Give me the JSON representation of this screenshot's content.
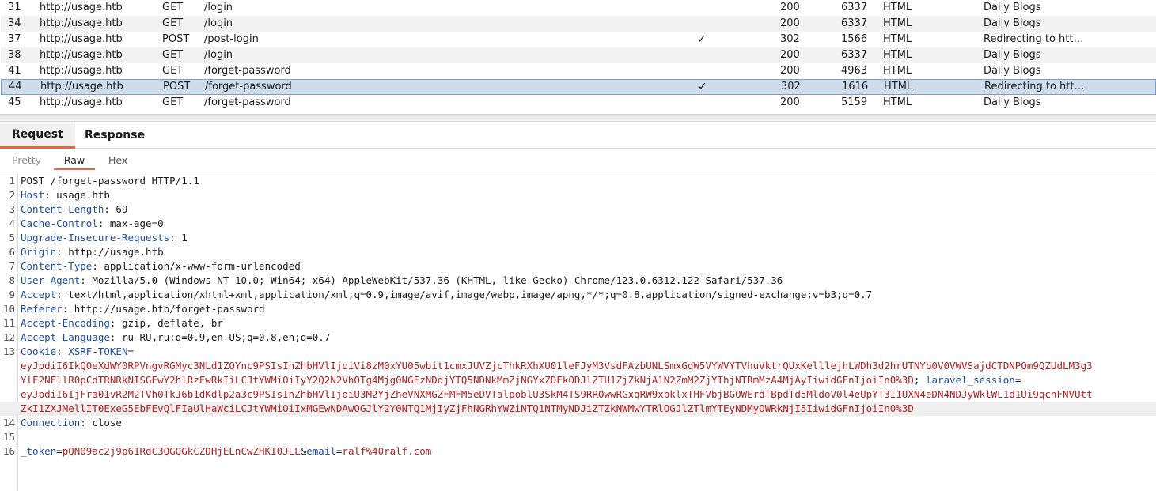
{
  "history": {
    "rows": [
      {
        "num": "31",
        "host": "http://usage.htb",
        "method": "GET",
        "url": "/login",
        "edited": "",
        "status": "200",
        "length": "6337",
        "mime": "HTML",
        "title": "Daily Blogs"
      },
      {
        "num": "34",
        "host": "http://usage.htb",
        "method": "GET",
        "url": "/login",
        "edited": "",
        "status": "200",
        "length": "6337",
        "mime": "HTML",
        "title": "Daily Blogs"
      },
      {
        "num": "37",
        "host": "http://usage.htb",
        "method": "POST",
        "url": "/post-login",
        "edited": "✓",
        "status": "302",
        "length": "1566",
        "mime": "HTML",
        "title": "Redirecting to htt…"
      },
      {
        "num": "38",
        "host": "http://usage.htb",
        "method": "GET",
        "url": "/login",
        "edited": "",
        "status": "200",
        "length": "6337",
        "mime": "HTML",
        "title": "Daily Blogs"
      },
      {
        "num": "41",
        "host": "http://usage.htb",
        "method": "GET",
        "url": "/forget-password",
        "edited": "",
        "status": "200",
        "length": "4963",
        "mime": "HTML",
        "title": "Daily Blogs"
      },
      {
        "num": "44",
        "host": "http://usage.htb",
        "method": "POST",
        "url": "/forget-password",
        "edited": "✓",
        "status": "302",
        "length": "1616",
        "mime": "HTML",
        "title": "Redirecting to htt…"
      },
      {
        "num": "45",
        "host": "http://usage.htb",
        "method": "GET",
        "url": "/forget-password",
        "edited": "",
        "status": "200",
        "length": "5159",
        "mime": "HTML",
        "title": "Daily Blogs"
      }
    ]
  },
  "tabs": {
    "request": "Request",
    "response": "Response"
  },
  "subtabs": {
    "pretty": "Pretty",
    "raw": "Raw",
    "hex": "Hex"
  },
  "editor": {
    "lines": [
      {
        "n": "1",
        "plain": "POST /forget-password HTTP/1.1"
      },
      {
        "n": "2",
        "name": "Host",
        "value": "usage.htb"
      },
      {
        "n": "3",
        "name": "Content-Length",
        "value": "69"
      },
      {
        "n": "4",
        "name": "Cache-Control",
        "value": "max-age=0"
      },
      {
        "n": "5",
        "name": "Upgrade-Insecure-Requests",
        "value": "1"
      },
      {
        "n": "6",
        "name": "Origin",
        "value": "http://usage.htb"
      },
      {
        "n": "7",
        "name": "Content-Type",
        "value": "application/x-www-form-urlencoded"
      },
      {
        "n": "8",
        "name": "User-Agent",
        "value": "Mozilla/5.0 (Windows NT 10.0; Win64; x64) AppleWebKit/537.36 (KHTML, like Gecko) Chrome/123.0.6312.122 Safari/537.36"
      },
      {
        "n": "9",
        "name": "Accept",
        "value": "text/html,application/xhtml+xml,application/xml;q=0.9,image/avif,image/webp,image/apng,*/*;q=0.8,application/signed-exchange;v=b3;q=0.7"
      },
      {
        "n": "10",
        "name": "Referer",
        "value": "http://usage.htb/forget-password"
      },
      {
        "n": "11",
        "name": "Accept-Encoding",
        "value": "gzip, deflate, br"
      },
      {
        "n": "12",
        "name": "Accept-Language",
        "value": "ru-RU,ru;q=0.9,en-US;q=0.8,en;q=0.7"
      },
      {
        "n": "13",
        "name": "Cookie",
        "cookie": true
      },
      {
        "n": "14",
        "name": "Connection",
        "value": "close"
      },
      {
        "n": "15",
        "empty": true
      },
      {
        "n": "16",
        "body": true
      }
    ],
    "cookie": {
      "xsrf_name": "XSRF-TOKEN",
      "xsrf_value_1": "eyJpdiI6IkQ0eXdWY0RPVngvRGMyc3NLd1ZQYnc9PSIsInZhbHVlIjoiVi8zM0xYU05wbit1cmxJUVZjcThkRXhXU01leFJyM3VsdFAzbUNLSmxGdW5VYWVYTVhuVktrQUxKelllejhLWDh3d2hrUTNYb0V0VWVSajdCTDNPQm9QZUdLM3g3",
      "xsrf_value_2": "YlF2NFllR0pCdTRNRkNISGEwY2hlRzFwRkIiLCJtYWMiOiIyY2Q2N2VhOTg4Mjg0NGEzNDdjYTQ5NDNkMmZjNGYxZDFkODJlZTU1ZjZkNjA1N2ZmM2ZjYThjNTRmMzA4MjAyIiwidGFnIjoiIn0%3D",
      "laravel_name": "laravel_session",
      "laravel_value_1": "eyJpdiI6IjFra01vR2M2TVh0TkJ6b1dKdlp2a3c9PSIsInZhbHVlIjoiU3M2YjZheVNXMGZFMFM5eDVTalpoblU3SkM4TS9RR0wwRGxqRW9xbklxTHFVbjBGOWErdTBpdTd5MldoV0l4eUpYT3I1UXN4eDN4NDJyWklWL1d1Ui9qcnFNVUtt",
      "laravel_value_2": "ZkI1ZXJMellIT0ExeG5EbFEvQlFIaUlHaWciLCJtYWMiOiIxMGEwNDAwOGJlY2Y0NTQ1MjIyZjFhNGRhYWZiNTQ1NTMyNDJiZTZkNWMwYTRlOGJlZTlmYTEyNDMyOWRkNjI5IiwidGFnIjoiIn0%3D"
    },
    "body": {
      "token_name": "_token",
      "token_value": "pQN09ac2j9p61RdC3QGQGkCZDHjELnCwZHKI0JLL",
      "email_name": "email",
      "email_value": "ralf%40ralf.com"
    }
  }
}
